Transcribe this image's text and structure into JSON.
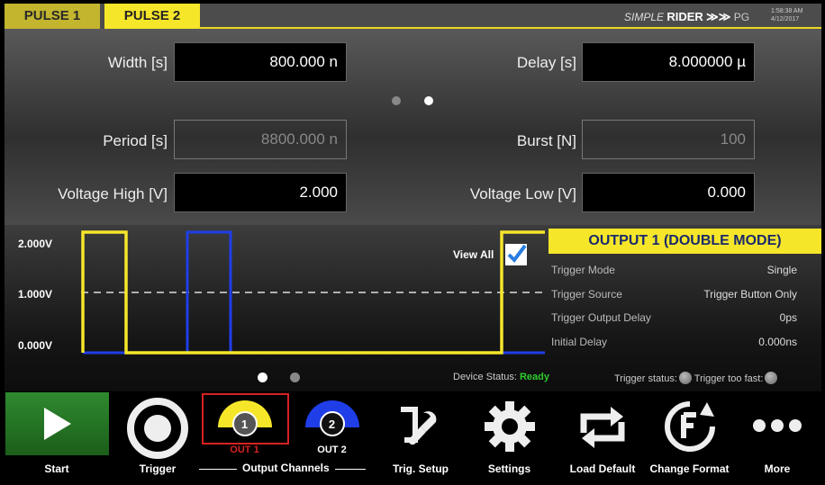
{
  "tabs": [
    {
      "label": "PULSE 1",
      "active": false
    },
    {
      "label": "PULSE 2",
      "active": true
    }
  ],
  "brand": {
    "name": "SIMPLE",
    "name_bold": "RIDER",
    "arrows": "≫≫",
    "suffix": "PG"
  },
  "clock": {
    "time": "1:58:38 AM",
    "date": "4/12/2017"
  },
  "params": {
    "width": {
      "label": "Width [s]",
      "value": "800.000 n"
    },
    "delay": {
      "label": "Delay [s]",
      "value": "8.000000 µ"
    },
    "period": {
      "label": "Period [s]",
      "value": "8800.000 n"
    },
    "burst": {
      "label": "Burst [N]",
      "value": "100"
    },
    "vhigh": {
      "label": "Voltage High [V]",
      "value": "2.000"
    },
    "vlow": {
      "label": "Voltage Low [V]",
      "value": "0.000"
    }
  },
  "waveform": {
    "levels": [
      "2.000V",
      "1.000V",
      "0.000V"
    ],
    "view_all_label": "View All",
    "view_all_checked": true,
    "colors": {
      "channel1": "#f6e62a",
      "channel2": "#1f3ee8",
      "accent": "#f6e62a"
    }
  },
  "output_panel": {
    "title": "OUTPUT 1 (DOUBLE MODE)",
    "rows": [
      {
        "label": "Trigger Mode",
        "value": "Single"
      },
      {
        "label": "Trigger Source",
        "value": "Trigger Button Only"
      },
      {
        "label": "Trigger Output Delay",
        "value": "0ps"
      },
      {
        "label": "Initial Delay",
        "value": "0.000ns"
      }
    ]
  },
  "status": {
    "device_label": "Device Status:",
    "device_value": "Ready",
    "trigger_status_label": "Trigger status:",
    "trigger_fast_label": "Trigger too fast:"
  },
  "toolbar": {
    "start": "Start",
    "trigger": "Trigger",
    "out1_number": "1",
    "out1_label": "OUT 1",
    "out2_number": "2",
    "out2_label": "OUT 2",
    "output_channels": "Output Channels",
    "trig_setup": "Trig. Setup",
    "settings": "Settings",
    "load_default": "Load Default",
    "change_format": "Change Format",
    "more": "More"
  }
}
